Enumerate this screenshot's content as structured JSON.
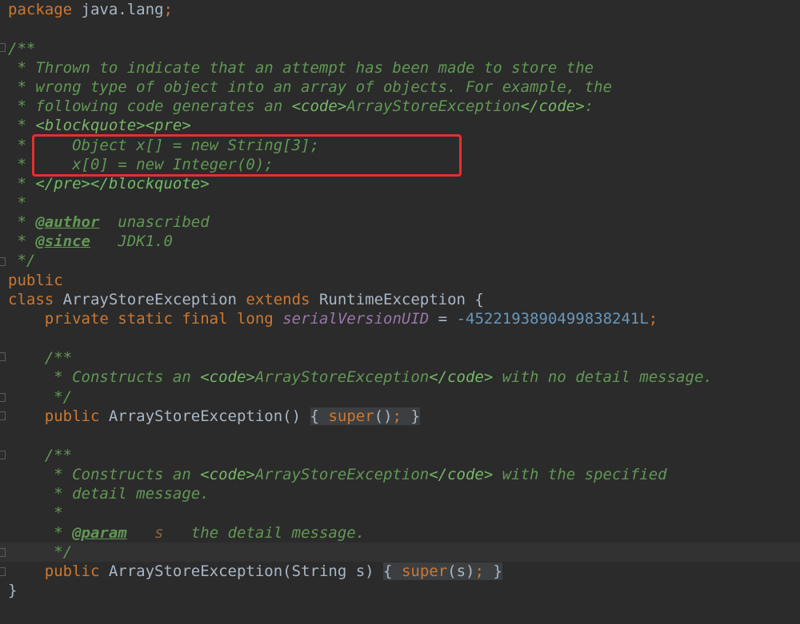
{
  "code": {
    "l01": {
      "kw": "package",
      "rest": " java.lang",
      "semi": ";"
    },
    "l03": {
      "text": "/**"
    },
    "l04": {
      "text": " * Thrown to indicate that an attempt has been made to store the"
    },
    "l05": {
      "text": " * wrong type of object into an array of objects. For example, the"
    },
    "l06": {
      "pre": " * following code generates an ",
      "t1": "<code>",
      "mid": "ArrayStoreException",
      "t2": "</code>",
      "post": ":"
    },
    "l07": {
      "pre": " * ",
      "t1": "<blockquote>",
      "t2": "<pre>"
    },
    "l08": {
      "star": " *",
      "text": "     Object x[] = new String[3];"
    },
    "l09": {
      "star": " *",
      "text": "     x[0] = new Integer(0);"
    },
    "l10": {
      "pre": " * ",
      "t1": "</pre>",
      "t2": "</blockquote>"
    },
    "l11": {
      "text": " *"
    },
    "l12": {
      "pre": " * ",
      "tag": "@author",
      "rest": "  unascribed"
    },
    "l13": {
      "pre": " * ",
      "tag": "@since",
      "rest": "   JDK1.0"
    },
    "l14": {
      "text": " */"
    },
    "l15": {
      "kw": "public"
    },
    "l16": {
      "kw1": "class",
      "name": " ArrayStoreException ",
      "kw2": "extends",
      "rest": " RuntimeException {"
    },
    "l17": {
      "indent": "    ",
      "kw": "private static final long",
      "field": "serialVersionUID",
      "eq": " = ",
      "num": "-4522193890499838241L",
      "semi": ";"
    },
    "l19": {
      "text": "    /**"
    },
    "l20": {
      "pre": "     * Constructs an ",
      "t1": "<code>",
      "mid": "ArrayStoreException",
      "t2": "</code>",
      "post": " with no detail message."
    },
    "l21": {
      "text": "     */"
    },
    "l22": {
      "indent": "    ",
      "kw": "public",
      "name": " ArrayStoreException()",
      "b1": "{",
      "kw2": "super",
      "call": "()",
      "semi": ";",
      "b2": "}"
    },
    "l24": {
      "text": "    /**"
    },
    "l25": {
      "pre": "     * Constructs an ",
      "t1": "<code>",
      "mid": "ArrayStoreException",
      "t2": "</code>",
      "post": " with the specified"
    },
    "l26": {
      "text": "     * detail message."
    },
    "l27": {
      "text": "     *"
    },
    "l28": {
      "pre": "     * ",
      "tag": "@param",
      "p": "s",
      "rest": "   the detail message."
    },
    "l29": {
      "text": "     */"
    },
    "l30": {
      "indent": "    ",
      "kw": "public",
      "name": " ArrayStoreException(String s)",
      "b1": "{",
      "kw2": "super",
      "call": "(s)",
      "semi": ";",
      "b2": "}"
    },
    "l31": {
      "text": "}"
    }
  },
  "colors": {
    "background": "#2b2b2b",
    "keyword": "#cc7832",
    "comment": "#629755",
    "field": "#9876aa",
    "number": "#6897bb",
    "highlight_box": "#e0322d"
  }
}
